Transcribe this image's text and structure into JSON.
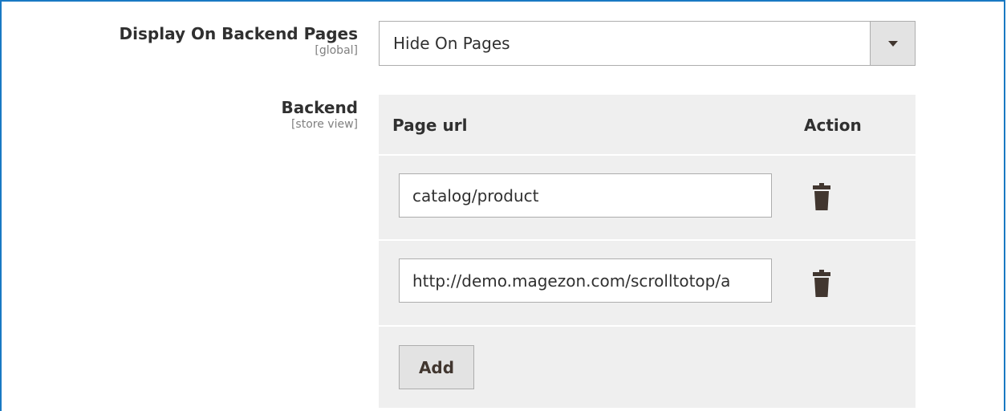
{
  "display_backend": {
    "label": "Display On Backend Pages",
    "scope": "[global]",
    "selected": "Hide On Pages"
  },
  "backend": {
    "label": "Backend",
    "scope": "[store view]",
    "columns": {
      "page_url": "Page url",
      "action": "Action"
    },
    "rows": [
      {
        "page_url": "catalog/product"
      },
      {
        "page_url": "http://demo.magezon.com/scrolltotop/a"
      }
    ],
    "add_label": "Add"
  },
  "colors": {
    "frame_border": "#1979c3",
    "table_bg": "#efefef",
    "icon": "#41362f"
  }
}
